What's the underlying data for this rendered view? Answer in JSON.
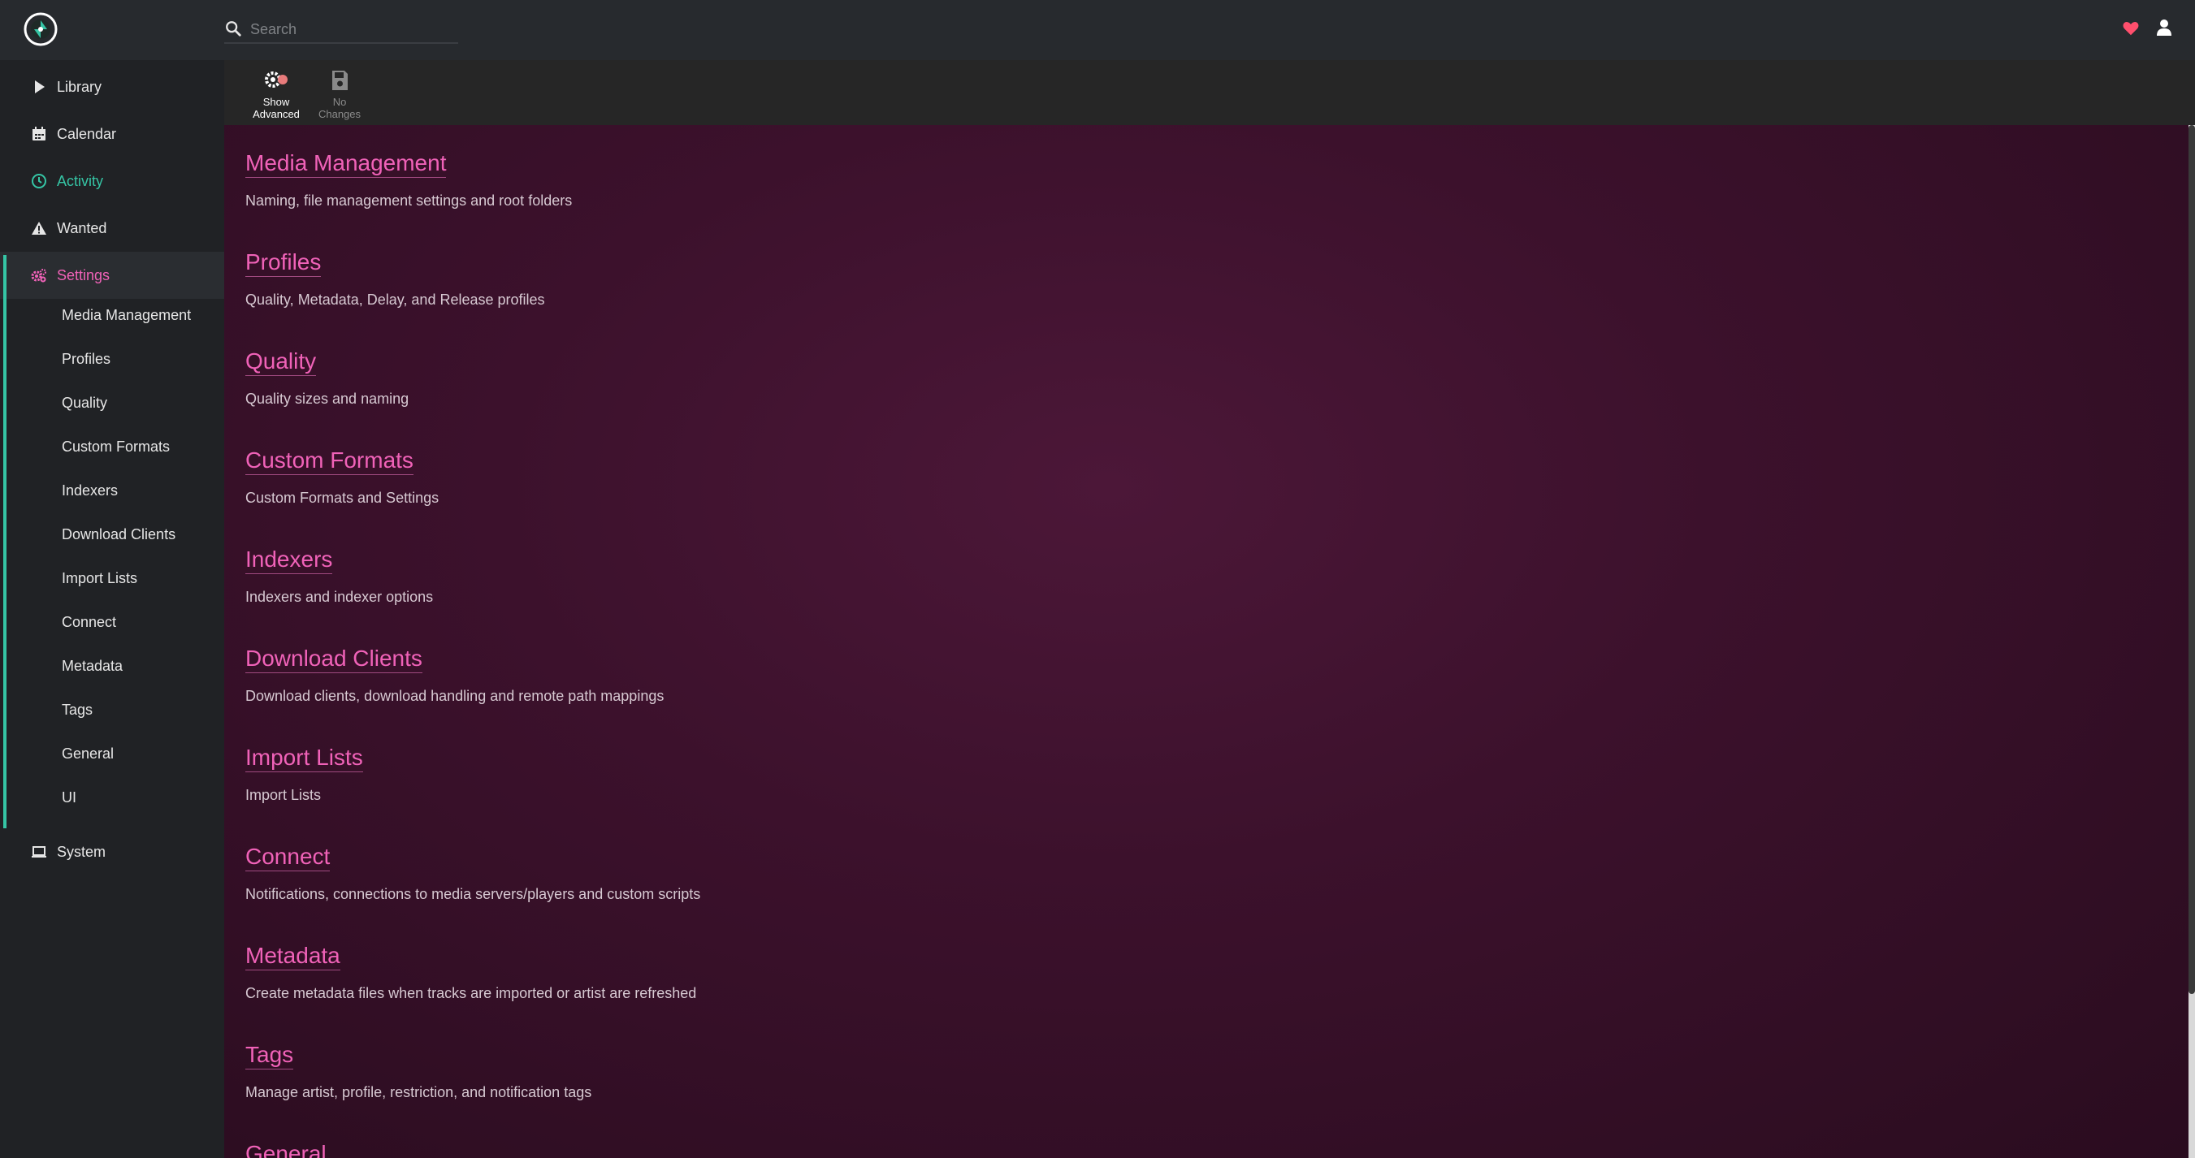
{
  "header": {
    "search": {
      "placeholder": "Search",
      "value": ""
    }
  },
  "sidebar": {
    "items": [
      {
        "label": "Library",
        "icon": "play-icon"
      },
      {
        "label": "Calendar",
        "icon": "calendar-icon"
      },
      {
        "label": "Activity",
        "icon": "clock-icon"
      },
      {
        "label": "Wanted",
        "icon": "warning-icon"
      },
      {
        "label": "Settings",
        "icon": "gears-icon"
      },
      {
        "label": "System",
        "icon": "laptop-icon"
      }
    ],
    "settings_sub": [
      "Media Management",
      "Profiles",
      "Quality",
      "Custom Formats",
      "Indexers",
      "Download Clients",
      "Import Lists",
      "Connect",
      "Metadata",
      "Tags",
      "General",
      "UI"
    ]
  },
  "toolbar": {
    "show_advanced": [
      "Show",
      "Advanced"
    ],
    "no_changes": [
      "No",
      "Changes"
    ]
  },
  "sections": [
    {
      "title": "Media Management",
      "desc": "Naming, file management settings and root folders"
    },
    {
      "title": "Profiles",
      "desc": "Quality, Metadata, Delay, and Release profiles"
    },
    {
      "title": "Quality",
      "desc": "Quality sizes and naming"
    },
    {
      "title": "Custom Formats",
      "desc": "Custom Formats and Settings"
    },
    {
      "title": "Indexers",
      "desc": "Indexers and indexer options"
    },
    {
      "title": "Download Clients",
      "desc": "Download clients, download handling and remote path mappings"
    },
    {
      "title": "Import Lists",
      "desc": "Import Lists"
    },
    {
      "title": "Connect",
      "desc": "Notifications, connections to media servers/players and custom scripts"
    },
    {
      "title": "Metadata",
      "desc": "Create metadata files when tracks are imported or artist are refreshed"
    },
    {
      "title": "Tags",
      "desc": "Manage artist, profile, restriction, and notification tags"
    },
    {
      "title": "General",
      "desc": ""
    }
  ],
  "colors": {
    "accent_pink": "#f062b8",
    "accent_green": "#35c5a5",
    "heart_red": "#ff4f6d"
  }
}
